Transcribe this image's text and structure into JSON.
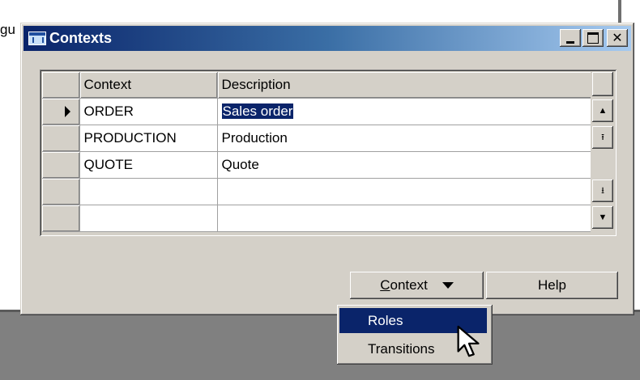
{
  "background": {
    "cut_text": "gu"
  },
  "window": {
    "title": "Contexts",
    "controls": {
      "minimize": "_",
      "maximize": "□",
      "close": "✕"
    }
  },
  "grid": {
    "columns": [
      "Context",
      "Description"
    ],
    "rows": [
      {
        "context": "ORDER",
        "description": "Sales order",
        "current": true
      },
      {
        "context": "PRODUCTION",
        "description": "Production"
      },
      {
        "context": "QUOTE",
        "description": "Quote"
      },
      {
        "context": "",
        "description": ""
      },
      {
        "context": "",
        "description": ""
      }
    ]
  },
  "buttons": {
    "context": {
      "mnemonic": "C",
      "rest": "ontext"
    },
    "help": "Help"
  },
  "popup_menu": {
    "items": [
      "Roles",
      "Transitions"
    ],
    "highlighted": "Roles"
  },
  "colors": {
    "title_start": "#0a246a",
    "title_end": "#a6caf0",
    "face": "#d4d0c8",
    "selection": "#0a246a"
  }
}
